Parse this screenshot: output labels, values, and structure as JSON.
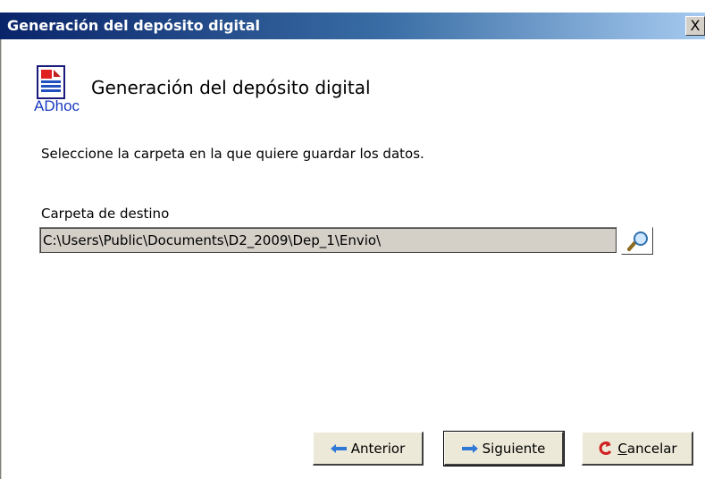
{
  "window": {
    "title": "Generación del depósito digital",
    "close_label": "X"
  },
  "header": {
    "logo_icon": "adhoc-document-icon",
    "logo_text": "ADhoc",
    "title": "Generación del depósito digital"
  },
  "main": {
    "instruction": "Seleccione la carpeta en la que quiere guardar los datos.",
    "destination": {
      "label": "Carpeta de destino",
      "value": "C:\\Users\\Public\\Documents\\D2_2009\\Dep_1\\Envio\\",
      "browse_icon": "magnifier-icon"
    }
  },
  "footer": {
    "previous": {
      "label": "Anterior",
      "icon": "arrow-left-icon"
    },
    "next": {
      "label": "Siguiente",
      "icon": "arrow-right-icon"
    },
    "cancel": {
      "label_accel": "C",
      "label_rest": "ancelar",
      "icon": "cancel-icon"
    }
  },
  "colors": {
    "titlebar_start": "#0a246a",
    "titlebar_end": "#a6caf0",
    "face": "#d4d0c8"
  }
}
